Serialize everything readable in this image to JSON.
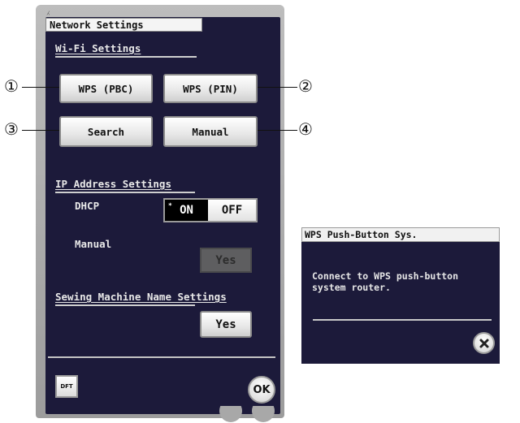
{
  "window": {
    "title": "Network Settings"
  },
  "wifi": {
    "heading": "Wi-Fi Settings",
    "wps_pbc": "WPS (PBC)",
    "wps_pin": "WPS (PIN)",
    "search": "Search",
    "manual": "Manual"
  },
  "ip": {
    "heading": "IP Address Settings",
    "dhcp_label": "DHCP",
    "dhcp_on": "ON",
    "dhcp_off": "OFF",
    "dhcp_selected": "ON",
    "manual_label": "Manual",
    "manual_yes": "Yes"
  },
  "name_settings": {
    "heading": "Sewing Machine Name Settings",
    "yes": "Yes"
  },
  "footer": {
    "dft": "DFT",
    "ok": "OK"
  },
  "callouts": [
    "①",
    "②",
    "③",
    "④"
  ],
  "dialog": {
    "title": "WPS Push-Button Sys.",
    "message_line1": "Connect to WPS push-button",
    "message_line2": "system router.",
    "close_icon": "close-icon"
  },
  "colors": {
    "panel_background": "#1c1a3a",
    "toggle_selected": "#000000"
  }
}
